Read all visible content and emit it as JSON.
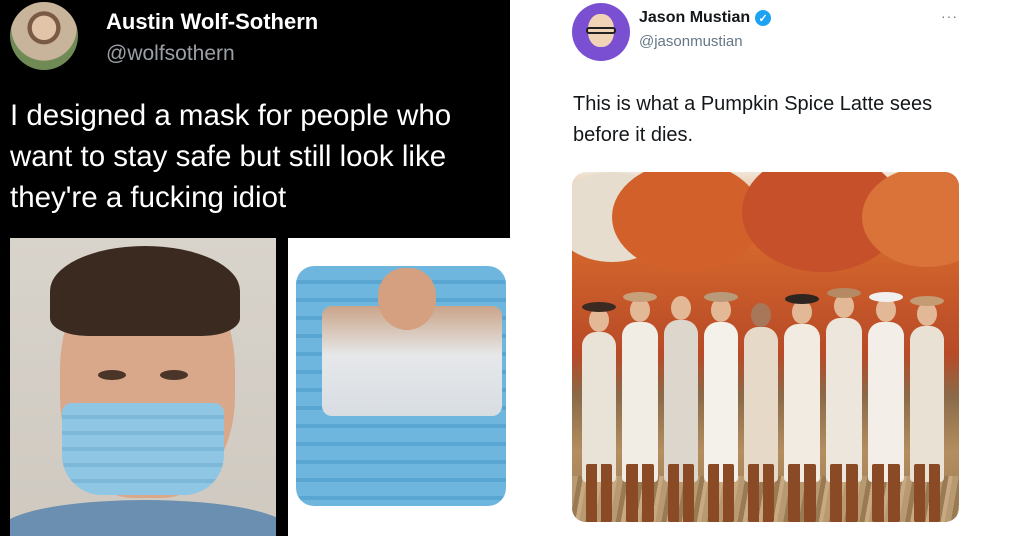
{
  "left_tweet": {
    "author_name": "Austin Wolf-Sothern",
    "author_handle": "@wolfsothern",
    "text": "I designed a mask for people who want to stay safe but still look like they're a fucking idiot"
  },
  "right_tweet": {
    "author_name": "Jason Mustian",
    "author_handle": "@jasonmustian",
    "more_label": "···",
    "text": "This is what a Pumpkin Spice Latte sees before it dies."
  },
  "colors": {
    "dark_bg": "#000000",
    "verified_blue": "#1da1f2",
    "light_text": "#14171a",
    "muted_text": "#657786"
  }
}
